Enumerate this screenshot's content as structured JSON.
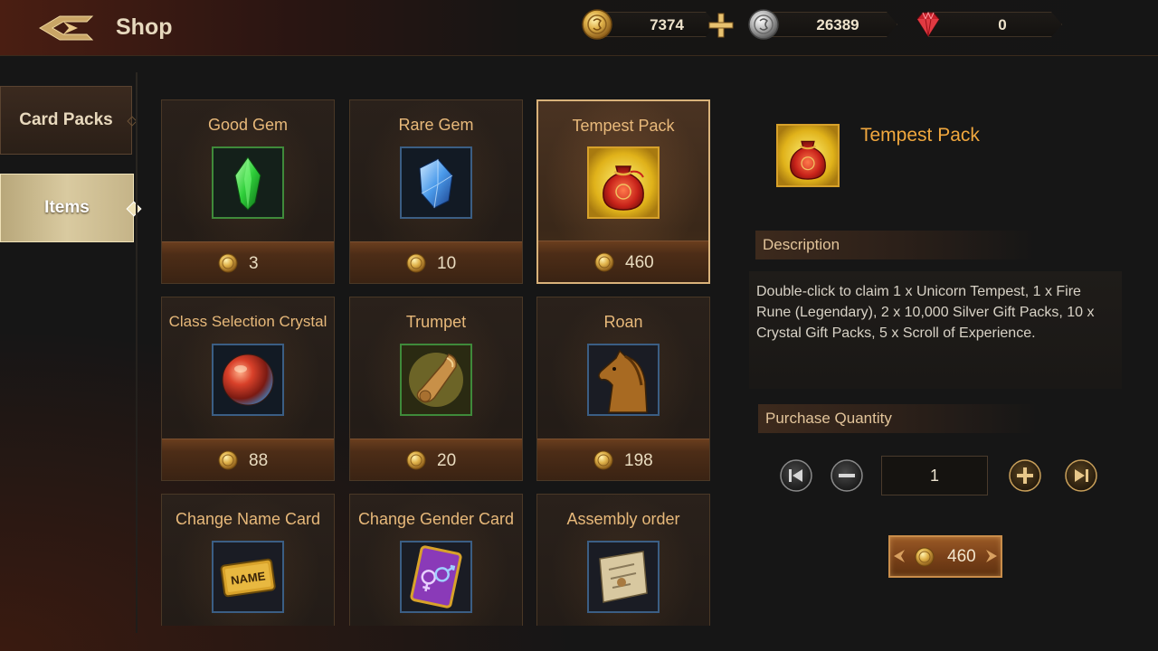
{
  "header": {
    "title": "Shop",
    "currencies": {
      "gold": "7374",
      "silver": "26389",
      "gems": "0"
    }
  },
  "sidebar": {
    "tabs": [
      {
        "label": "Card Packs",
        "active": false
      },
      {
        "label": "Items",
        "active": true
      }
    ]
  },
  "items": [
    {
      "name": "Good Gem",
      "price": "3",
      "icon": "green-gem-icon"
    },
    {
      "name": "Rare Gem",
      "price": "10",
      "icon": "blue-gem-icon"
    },
    {
      "name": "Tempest Pack",
      "price": "460",
      "icon": "red-pouch-icon",
      "selected": true
    },
    {
      "name": "Class Selection Crystal",
      "price": "88",
      "icon": "red-orb-icon"
    },
    {
      "name": "Trumpet",
      "price": "20",
      "icon": "horn-icon"
    },
    {
      "name": "Roan",
      "price": "198",
      "icon": "horse-icon"
    },
    {
      "name": "Change Name Card",
      "price": "",
      "icon": "name-card-icon"
    },
    {
      "name": "Change Gender Card",
      "price": "",
      "icon": "gender-card-icon"
    },
    {
      "name": "Assembly order",
      "price": "",
      "icon": "scroll-icon"
    }
  ],
  "detail": {
    "name": "Tempest Pack",
    "description_label": "Description",
    "description": "Double-click to claim 1 x Unicorn Tempest, 1 x Fire Rune (Legendary), 2 x 10,000 Silver Gift Packs, 10 x Crystal Gift Packs, 5 x Scroll of Experience.",
    "quantity_label": "Purchase Quantity",
    "quantity": "1",
    "total_price": "460"
  },
  "colors": {
    "accent_gold": "#f0a73e",
    "card_title": "#e8b97a",
    "selected_border": "#d9b27a"
  }
}
